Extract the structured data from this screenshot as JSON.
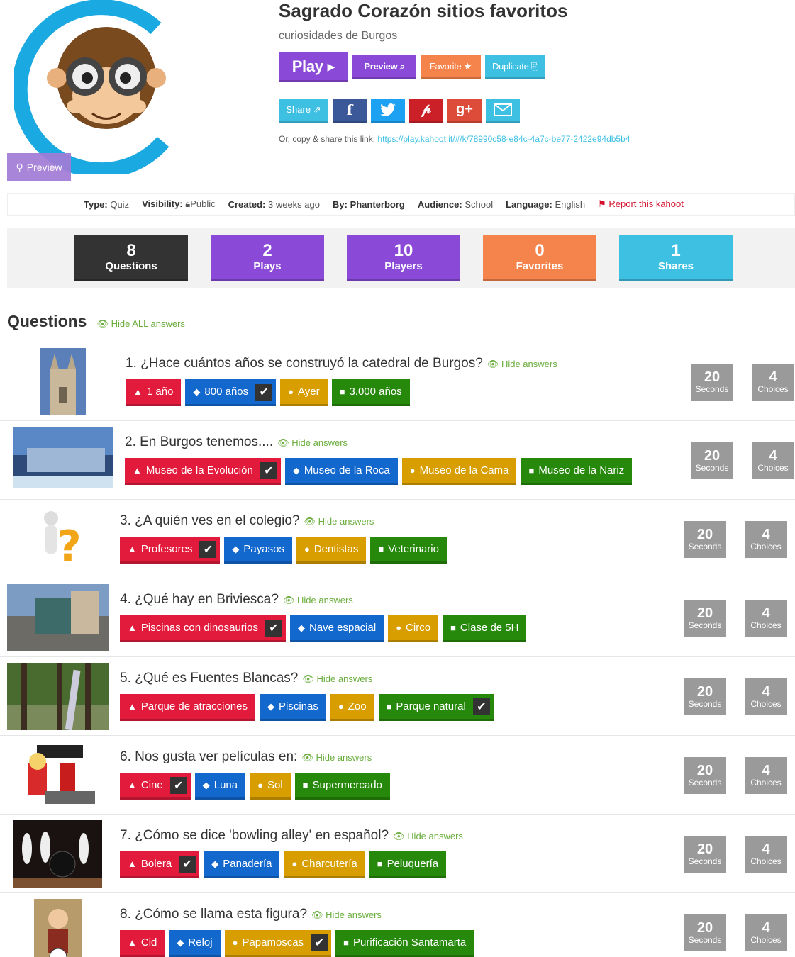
{
  "header": {
    "title": "Sagrado Corazón sitios favoritos",
    "subtitle": "curiosidades de Burgos",
    "cover_preview_label": "Preview"
  },
  "actions": {
    "play": "Play ▸",
    "preview": "Preview ⌕",
    "favorite": "Favorite ★",
    "duplicate": "Duplicate ⎘"
  },
  "share": {
    "share_label": "Share ⇗",
    "link_prefix": "Or, copy & share this link:",
    "link_url": "https://play.kahoot.it/#/k/78990c58-e84c-4a7c-be77-2422e94db5b4"
  },
  "meta": {
    "type_label": "Type:",
    "type_value": "Quiz",
    "visibility_label": "Visibility:",
    "visibility_value": "Public",
    "created_label": "Created:",
    "created_value": "3 weeks ago",
    "by_label": "By:",
    "by_value": "Phanterborg",
    "audience_label": "Audience:",
    "audience_value": "School",
    "language_label": "Language:",
    "language_value": "English",
    "report": "Report this kahoot"
  },
  "stats": [
    {
      "number": "8",
      "label": "Questions",
      "color": "#333333"
    },
    {
      "number": "2",
      "label": "Plays",
      "color": "#8a49d6"
    },
    {
      "number": "10",
      "label": "Players",
      "color": "#8a49d6"
    },
    {
      "number": "0",
      "label": "Favorites",
      "color": "#f5844c"
    },
    {
      "number": "1",
      "label": "Shares",
      "color": "#3ec0e3"
    }
  ],
  "questions_heading": "Questions",
  "hide_all": "Hide ALL answers",
  "hide_answers": "Hide answers",
  "tile_seconds_label": "Seconds",
  "tile_choices_label": "Choices",
  "questions": [
    {
      "title": "1. ¿Hace cuántos años se construyó la catedral de Burgos?",
      "seconds": "20",
      "choices": "4",
      "answers": [
        {
          "text": "1 año",
          "correct": false
        },
        {
          "text": "800 años",
          "correct": true
        },
        {
          "text": "Ayer",
          "correct": false
        },
        {
          "text": "3.000 años",
          "correct": false
        }
      ]
    },
    {
      "title": "2. En Burgos tenemos....",
      "seconds": "20",
      "choices": "4",
      "answers": [
        {
          "text": "Museo de la Evolución",
          "correct": true
        },
        {
          "text": "Museo de la Roca",
          "correct": false
        },
        {
          "text": "Museo de la Cama",
          "correct": false
        },
        {
          "text": "Museo de la Nariz",
          "correct": false
        }
      ]
    },
    {
      "title": "3. ¿A quién ves en el colegio?",
      "seconds": "20",
      "choices": "4",
      "answers": [
        {
          "text": "Profesores",
          "correct": true
        },
        {
          "text": "Payasos",
          "correct": false
        },
        {
          "text": "Dentistas",
          "correct": false
        },
        {
          "text": "Veterinario",
          "correct": false
        }
      ]
    },
    {
      "title": "4. ¿Qué hay en Briviesca?",
      "seconds": "20",
      "choices": "4",
      "answers": [
        {
          "text": "Piscinas con dinosaurios",
          "correct": true
        },
        {
          "text": "Nave espacial",
          "correct": false
        },
        {
          "text": "Circo",
          "correct": false
        },
        {
          "text": "Clase de 5H",
          "correct": false
        }
      ]
    },
    {
      "title": "5. ¿Qué es Fuentes Blancas?",
      "seconds": "20",
      "choices": "4",
      "answers": [
        {
          "text": "Parque de atracciones",
          "correct": false
        },
        {
          "text": "Piscinas",
          "correct": false
        },
        {
          "text": "Zoo",
          "correct": false
        },
        {
          "text": "Parque natural",
          "correct": true
        }
      ]
    },
    {
      "title": "6. Nos gusta ver películas en:",
      "seconds": "20",
      "choices": "4",
      "answers": [
        {
          "text": "Cine",
          "correct": true
        },
        {
          "text": "Luna",
          "correct": false
        },
        {
          "text": "Sol",
          "correct": false
        },
        {
          "text": "Supermercado",
          "correct": false
        }
      ]
    },
    {
      "title": "7. ¿Cómo se dice 'bowling alley' en español?",
      "seconds": "20",
      "choices": "4",
      "answers": [
        {
          "text": "Bolera",
          "correct": true
        },
        {
          "text": "Panadería",
          "correct": false
        },
        {
          "text": "Charcutería",
          "correct": false
        },
        {
          "text": "Peluquería",
          "correct": false
        }
      ]
    },
    {
      "title": "8. ¿Cómo se llama esta figura?",
      "seconds": "20",
      "choices": "4",
      "answers": [
        {
          "text": "Cid",
          "correct": false
        },
        {
          "text": "Reloj",
          "correct": false
        },
        {
          "text": "Papamoscas",
          "correct": true
        },
        {
          "text": "Purificación Santamarta",
          "correct": false
        }
      ]
    }
  ],
  "answer_colors": [
    "#e21b3c",
    "#1368ce",
    "#d89e00",
    "#26890c"
  ],
  "answer_shape_icons": [
    "triangle-icon",
    "diamond-icon",
    "circle-icon",
    "square-icon"
  ]
}
